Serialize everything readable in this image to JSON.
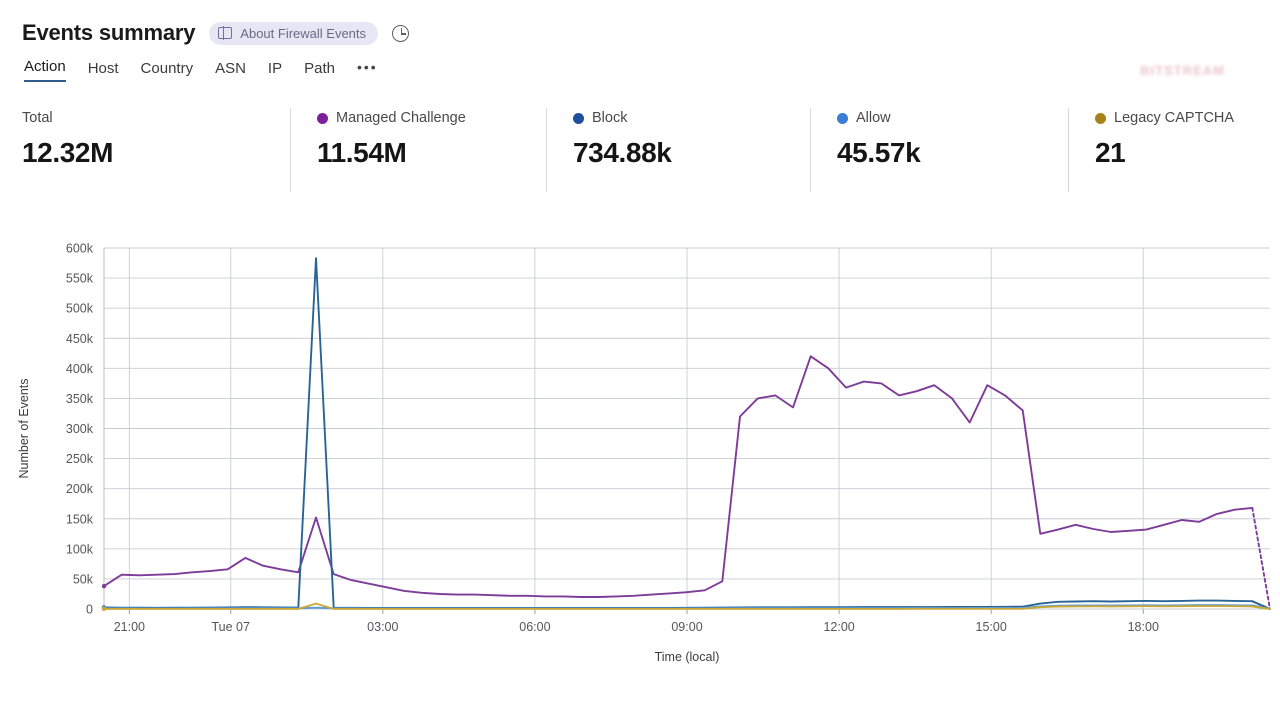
{
  "header": {
    "title": "Events summary",
    "about_pill": "About Firewall Events",
    "about_icon": "book-icon",
    "clock_icon": "pie-clock-icon"
  },
  "watermark": {
    "text": "BITSTREAM"
  },
  "tabs": [
    {
      "label": "Action",
      "active": true
    },
    {
      "label": "Host",
      "active": false
    },
    {
      "label": "Country",
      "active": false
    },
    {
      "label": "ASN",
      "active": false
    },
    {
      "label": "IP",
      "active": false
    },
    {
      "label": "Path",
      "active": false
    }
  ],
  "tabs_more": "•••",
  "stats": [
    {
      "label": "Total",
      "value": "12.32M",
      "color": ""
    },
    {
      "label": "Managed Challenge",
      "value": "11.54M",
      "color": "#7d1f9b"
    },
    {
      "label": "Block",
      "value": "734.88k",
      "color": "#1f4e9c"
    },
    {
      "label": "Allow",
      "value": "45.57k",
      "color": "#3a7fd5"
    },
    {
      "label": "Legacy CAPTCHA",
      "value": "21",
      "color": "#a8811b"
    }
  ],
  "chart_data": {
    "type": "line",
    "title": "",
    "xlabel": "Time (local)",
    "ylabel": "Number of Events",
    "ylim": [
      0,
      600000
    ],
    "ytick_values": [
      0,
      50000,
      100000,
      150000,
      200000,
      250000,
      300000,
      350000,
      400000,
      450000,
      500000,
      550000,
      600000
    ],
    "ytick_labels": [
      "0",
      "50k",
      "100k",
      "150k",
      "200k",
      "250k",
      "300k",
      "350k",
      "400k",
      "450k",
      "500k",
      "550k",
      "600k"
    ],
    "xtick_positions": [
      1,
      5,
      11,
      17,
      23,
      29,
      35,
      41
    ],
    "xtick_labels": [
      "21:00",
      "Tue 07",
      "03:00",
      "06:00",
      "09:00",
      "12:00",
      "15:00",
      "18:00"
    ],
    "xlim": [
      0,
      46
    ],
    "grid": true,
    "legend": "none",
    "series": [
      {
        "name": "Managed Challenge",
        "color": "#7d3c98",
        "values": [
          38000,
          57000,
          56000,
          57000,
          58000,
          61000,
          63000,
          66000,
          85000,
          72000,
          66000,
          61000,
          152000,
          58000,
          48000,
          42000,
          36000,
          30000,
          27000,
          25000,
          24000,
          24000,
          23000,
          22000,
          22000,
          21000,
          21000,
          20000,
          20000,
          21000,
          22000,
          24000,
          26000,
          28000,
          31000,
          46000,
          320000,
          350000,
          355000,
          335000,
          420000,
          400000,
          368000,
          378000,
          375000,
          355000,
          362000,
          372000,
          350000,
          310000,
          372000,
          355000,
          330000,
          125000,
          132000,
          140000,
          133000,
          128000,
          130000,
          132000,
          140000,
          148000,
          145000,
          158000,
          165000,
          168000,
          0
        ],
        "dashed_tail": true
      },
      {
        "name": "Block",
        "color": "#2a6496",
        "values": [
          2500,
          2200,
          2100,
          2000,
          2100,
          2200,
          2400,
          2600,
          3000,
          2800,
          2600,
          2400,
          583000,
          2200,
          2000,
          1900,
          1800,
          1700,
          1700,
          1600,
          1600,
          1600,
          1600,
          1600,
          1600,
          1600,
          1600,
          1600,
          1600,
          1700,
          1700,
          1800,
          1900,
          2000,
          2100,
          2300,
          2600,
          2800,
          2900,
          2900,
          3000,
          3000,
          3000,
          3100,
          3100,
          3100,
          3200,
          3200,
          3300,
          3400,
          3500,
          3600,
          3800,
          9000,
          12000,
          12500,
          13000,
          12500,
          13000,
          13500,
          13000,
          13500,
          14000,
          14000,
          13500,
          13000,
          0
        ]
      },
      {
        "name": "Allow",
        "color": "#5b9bd5",
        "values": [
          1200,
          1100,
          1050,
          1000,
          1050,
          1100,
          1150,
          1200,
          1400,
          1300,
          1250,
          1200,
          2200,
          1150,
          1100,
          1000,
          980,
          950,
          930,
          900,
          900,
          900,
          900,
          900,
          900,
          900,
          900,
          900,
          900,
          950,
          950,
          1000,
          1000,
          1050,
          1100,
          1150,
          1250,
          1300,
          1350,
          1350,
          1400,
          1400,
          1400,
          1450,
          1450,
          1450,
          1500,
          1500,
          1550,
          1600,
          1650,
          1700,
          1800,
          4200,
          5500,
          5800,
          6000,
          5800,
          6000,
          6200,
          6000,
          6200,
          6500,
          6500,
          6200,
          6000,
          0
        ]
      },
      {
        "name": "Legacy CAPTCHA",
        "color": "#c8a93a",
        "values": [
          200,
          180,
          170,
          160,
          170,
          180,
          190,
          200,
          230,
          210,
          200,
          190,
          9000,
          190,
          170,
          160,
          150,
          150,
          140,
          140,
          140,
          140,
          140,
          140,
          140,
          140,
          140,
          140,
          140,
          150,
          150,
          160,
          160,
          170,
          180,
          190,
          200,
          210,
          220,
          220,
          230,
          230,
          230,
          240,
          240,
          240,
          250,
          250,
          260,
          270,
          280,
          290,
          300,
          3000,
          4000,
          4300,
          4500,
          4300,
          4500,
          4600,
          4500,
          4600,
          4800,
          4800,
          4600,
          4400,
          0
        ]
      }
    ]
  }
}
